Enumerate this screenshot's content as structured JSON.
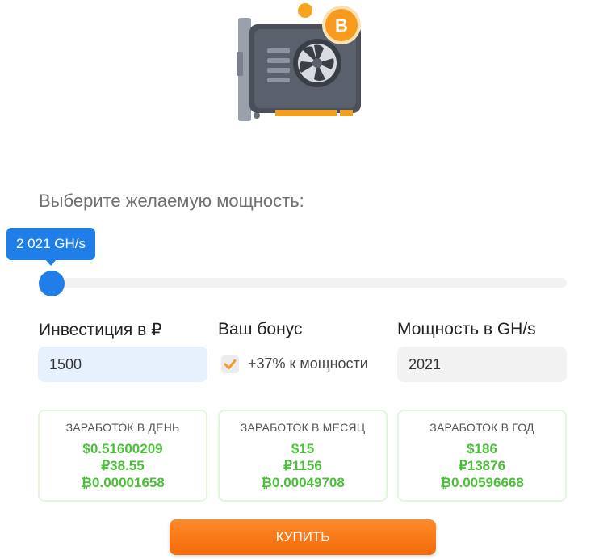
{
  "header": {
    "power_title": "Выберите желаемую мощность:"
  },
  "slider": {
    "tooltip": "2 021 GH/s",
    "level": 0.0
  },
  "form": {
    "investment": {
      "label": "Инвестиция в ₽",
      "value": "1500"
    },
    "bonus": {
      "label": "Ваш бонус",
      "checked": true,
      "text": "+37% к мощности"
    },
    "power": {
      "label": "Мощность в GH/s",
      "value": "2021"
    }
  },
  "earnings": [
    {
      "title": "ЗАРАБОТОК В ДЕНЬ",
      "usd": "$0.51600209",
      "rub": "₽38.55",
      "btc": "₿0.00001658"
    },
    {
      "title": "ЗАРАБОТОК В МЕСЯЦ",
      "usd": "$15",
      "rub": "₽1156",
      "btc": "₿0.00049708"
    },
    {
      "title": "ЗАРАБОТОК В ГОД",
      "usd": "$186",
      "rub": "₽13876",
      "btc": "₿0.00596668"
    }
  ],
  "buy_button": {
    "label": "КУПИТЬ"
  },
  "illustration": {
    "coin_letter": "B"
  },
  "colors": {
    "accent_blue": "#1f7ee8",
    "earn_green": "#4cbf3a",
    "button_orange": "#f57a1c",
    "checkbox_orange": "#f39a2e"
  }
}
